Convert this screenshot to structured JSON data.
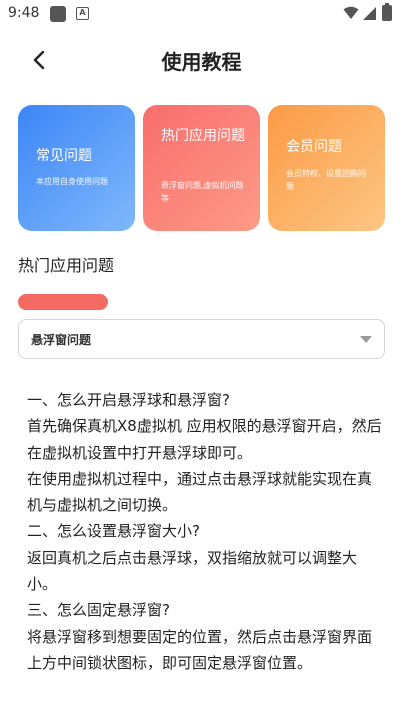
{
  "status_bar": {
    "time": "9:48",
    "icons": [
      "notification-icon",
      "a-badge-icon",
      "wifi-icon",
      "signal-icon",
      "battery-icon"
    ]
  },
  "header": {
    "back_icon": "chevron-left-icon",
    "title": "使用教程"
  },
  "cards": [
    {
      "title": "常见问题",
      "desc": "本应用自身使用问题",
      "color_from": "#3d86f7",
      "color_to": "#7fb8fb"
    },
    {
      "title": "热门应用问题",
      "desc": "悬浮窗问题,虚拟机问题等",
      "color_from": "#fa6d6d",
      "color_to": "#fc9b86"
    },
    {
      "title": "会员问题",
      "desc": "会员特权、设置团购问题",
      "color_from": "#fb9a45",
      "color_to": "#fdc784"
    }
  ],
  "section": {
    "title": "热门应用问题",
    "accent": "#f56b63"
  },
  "dropdown": {
    "selected": "悬浮窗问题"
  },
  "content": {
    "lines": [
      "一、怎么开启悬浮球和悬浮窗?",
      "首先确保真机X8虚拟机 应用权限的悬浮窗开启，然后在虚拟机设置中打开悬浮球即可。",
      "在使用虚拟机过程中，通过点击悬浮球就能实现在真机与虚拟机之间切换。",
      "二、怎么设置悬浮窗大小?",
      "返回真机之后点击悬浮球，双指缩放就可以调整大小。",
      "三、怎么固定悬浮窗?",
      "将悬浮窗移到想要固定的位置，然后点击悬浮窗界面上方中间锁状图标，即可固定悬浮窗位置。"
    ]
  }
}
